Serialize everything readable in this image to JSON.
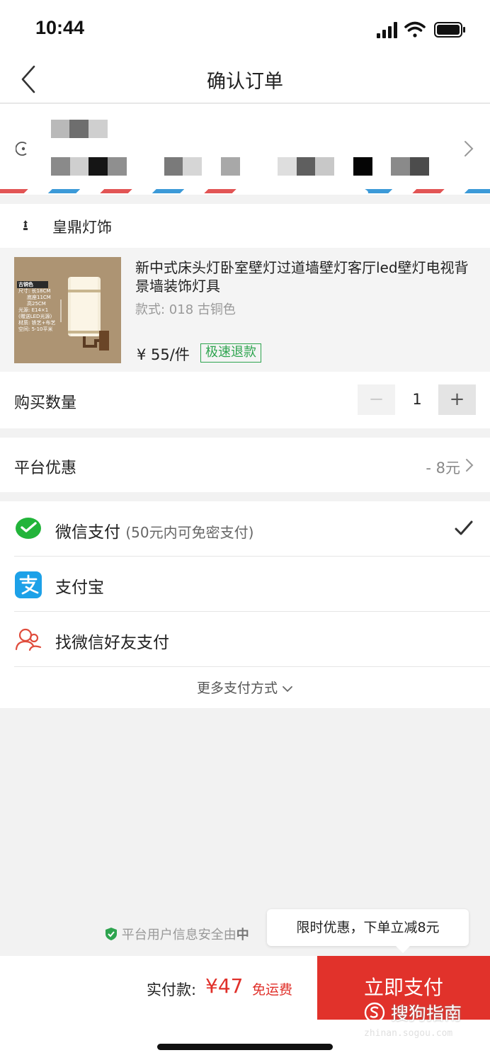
{
  "status_bar": {
    "time": "10:44"
  },
  "nav": {
    "title": "确认订单"
  },
  "shop": {
    "name": "皇鼎灯饰"
  },
  "product": {
    "title": "新中式床头灯卧室壁灯过道墙壁灯客厅led壁灯电视背景墙装饰灯具",
    "spec": "款式: 018 古铜色",
    "price": "¥ 55/件",
    "badge": "极速退款",
    "image_text": [
      "古铜色",
      "尺寸: 长18CM",
      "底座11CM",
      "高25CM",
      "光源: E14×1",
      "(赠送LED光源)",
      "材质: 铁艺+布艺",
      "空间: 5-10平米"
    ]
  },
  "quantity": {
    "label": "购买数量",
    "minus": "−",
    "value": "1",
    "plus": "+"
  },
  "promo": {
    "label": "平台优惠",
    "value": "- 8元"
  },
  "payment": {
    "wechat": {
      "label": "微信支付",
      "sub": "(50元内可免密支付)",
      "selected": true
    },
    "alipay": {
      "label": "支付宝"
    },
    "friend": {
      "label": "找微信好友支付"
    },
    "more": "更多支付方式"
  },
  "security_note": {
    "text": "平台用户信息安全由",
    "bold": "中"
  },
  "tooltip": {
    "text": "限时优惠，下单立减8元"
  },
  "bottom": {
    "total_label": "实付款:",
    "total_amount": "¥47",
    "shipping": "免运费",
    "pay_button": "立即支付"
  },
  "watermark": {
    "text": "搜狗指南",
    "url": "zhinan.sogou.com"
  },
  "colors": {
    "accent_red": "#e1322b",
    "green": "#2ea44f",
    "wechat_green": "#22b43a",
    "alipay_blue": "#1da1e8"
  }
}
